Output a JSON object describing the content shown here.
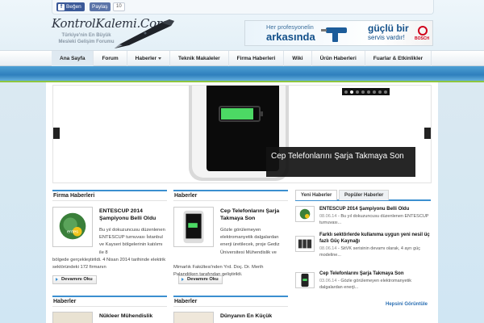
{
  "social": {
    "like_label": "Beğen",
    "share_label": "Paylaş",
    "count": "10"
  },
  "site": {
    "title": "KontrolKalemi.Com",
    "tagline": "Türkiye'nin En Büyük Mesleki Gelişim Forumu"
  },
  "banner": {
    "line1": "Her profesyonelin",
    "line2": "arkasında",
    "line3": "güçlü bir",
    "line4": "servis vardır!",
    "brand": "BOSCH"
  },
  "nav": {
    "items": [
      {
        "label": "Ana Sayfa",
        "dropdown": false
      },
      {
        "label": "Forum",
        "dropdown": false
      },
      {
        "label": "Haberler",
        "dropdown": true
      },
      {
        "label": "Teknik Makaleler",
        "dropdown": false
      },
      {
        "label": "Firma Haberleri",
        "dropdown": false
      },
      {
        "label": "Wiki",
        "dropdown": false
      },
      {
        "label": "Ürün Haberleri",
        "dropdown": false
      },
      {
        "label": "Fuarlar & Etkinlikler",
        "dropdown": false
      }
    ]
  },
  "slider": {
    "caption": "Cep Telefonlarını Şarja Takmaya Son",
    "dots": 8,
    "active_dot": 1
  },
  "col1": {
    "heading": "Firma Haberleri",
    "title": "ENTESCUP 2014 Şampiyonu Belli Oldu",
    "excerpt_a": "Bu yıl dokuzuncusu düzenlenen ENTESCUP turnuvası İstanbul ve Kayseri bölgelerinin katılımı ile 8",
    "excerpt_b": "bölgede gerçekleştirildi. 4 Nisan 2014 tarihinde elektrik sektöründeki 172 firmanın",
    "more": "Devamını Oku"
  },
  "col2": {
    "heading": "Haberler",
    "title": "Cep Telefonlarını Şarja Takmaya Son",
    "excerpt_a": "Gözle görülemeyen elektromanyetik dalgalardan enerji üretilecek, proje Gediz Üniversitesi Mühendislik ve",
    "excerpt_b": "Mimarlık Fakültesi'nden Yrd. Doç. Dr. Merih Palandöken tarafından geliştirildi.",
    "more": "Devamını Oku"
  },
  "col3": {
    "heading": "Haberler",
    "title": "Nükleer Mühendislik"
  },
  "col4": {
    "heading": "Haberler",
    "title": "Dünyanın En Küçük"
  },
  "tabs": {
    "tab1": "Yeni Haberler",
    "tab2": "Popüler Haberler",
    "items": [
      {
        "title": "ENTESCUP 2014 Şampiyonu Belli Oldu",
        "date": "08.06.14",
        "text": "Bu yıl dokuzuncusu düzenlenen ENTESCUP turnuvası..."
      },
      {
        "title": "Farklı sektörlerde kullanıma uygun yeni nesil üç fazlı Güç Kaynağı",
        "date": "08.06.14",
        "text": "SitVK serisinin devamı olarak, 4 ayrı güç modeline..."
      },
      {
        "title": "Cep Telefonlarını Şarja Takmaya Son",
        "date": "03.06.14",
        "text": "Gözle görülemeyen elektromanyetik dalgalardan enerji..."
      }
    ],
    "all_link": "Hepsini Görüntüle"
  },
  "colors": {
    "accent": "#3b8fd0",
    "band": "#2f7fbd",
    "green_line": "#8ec63f",
    "battery": "#4cd964"
  }
}
